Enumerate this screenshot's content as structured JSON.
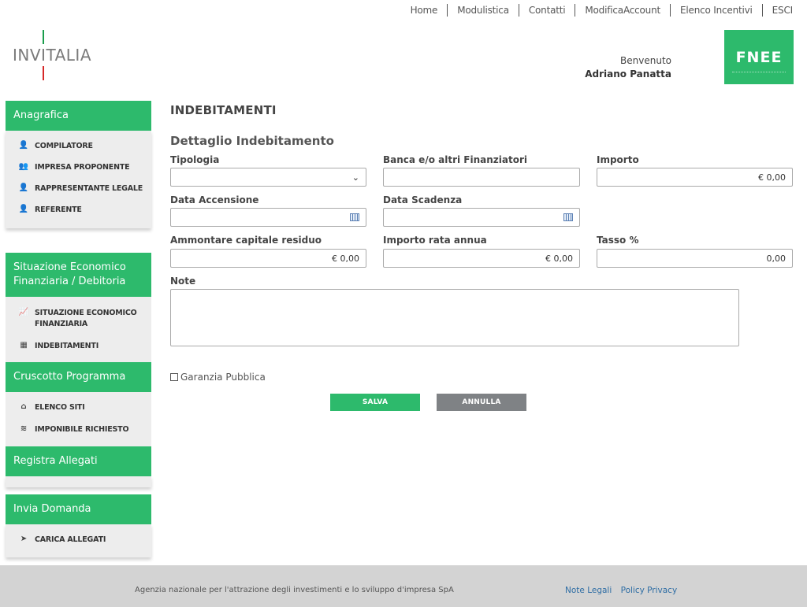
{
  "topnav": [
    "Home",
    "Modulistica",
    "Contatti",
    "ModificaAccount",
    "Elenco Incentivi",
    "ESCI"
  ],
  "brand": {
    "logo_text": "INVITALIA",
    "partner": "FNEE"
  },
  "user": {
    "greeting": "Benvenuto",
    "name": "Adriano Panatta"
  },
  "sidebar": [
    {
      "title": "Anagrafica",
      "items": [
        {
          "icon": "user-icon",
          "glyph": "👤",
          "label": "COMPILATORE"
        },
        {
          "icon": "users-icon",
          "glyph": "👥",
          "label": "IMPRESA PROPONENTE"
        },
        {
          "icon": "user-icon",
          "glyph": "👤",
          "label": "RAPPRESENTANTE LEGALE"
        },
        {
          "icon": "user-icon",
          "glyph": "👤",
          "label": "REFERENTE"
        }
      ]
    },
    {
      "title": "Situazione Economico Finanziaria / Debitoria",
      "items": [
        {
          "icon": "chart-line-icon",
          "glyph": "📈",
          "label": "SITUAZIONE ECONOMICO FINANZIARIA"
        },
        {
          "icon": "table-icon",
          "glyph": "▦",
          "label": "INDEBITAMENTI"
        }
      ]
    },
    {
      "title": "Cruscotto Programma",
      "items": [
        {
          "icon": "home-icon",
          "glyph": "⌂",
          "label": "ELENCO SITI"
        },
        {
          "icon": "coins-icon",
          "glyph": "≋",
          "label": "IMPONIBILE RICHIESTO"
        }
      ]
    },
    {
      "title": "Registra Allegati",
      "items": []
    },
    {
      "title": "Invia Domanda",
      "items": [
        {
          "icon": "send-icon",
          "glyph": "➤",
          "label": "CARICA ALLEGATI"
        }
      ]
    }
  ],
  "main": {
    "title": "INDEBITAMENTI",
    "subtitle": "Dettaglio Indebitamento",
    "fields": {
      "tipologia": {
        "label": "Tipologia",
        "value": ""
      },
      "banca": {
        "label": "Banca e/o altri Finanziatori",
        "value": ""
      },
      "importo": {
        "label": "Importo",
        "value": "€ 0,00"
      },
      "data_accensione": {
        "label": "Data Accensione",
        "value": ""
      },
      "data_scadenza": {
        "label": "Data Scadenza",
        "value": ""
      },
      "capitale_residuo": {
        "label": "Ammontare capitale residuo",
        "value": "€ 0,00"
      },
      "rata_annua": {
        "label": "Importo rata annua",
        "value": "€ 0,00"
      },
      "tasso": {
        "label": "Tasso %",
        "value": "0,00"
      },
      "note": {
        "label": "Note",
        "value": ""
      }
    },
    "garanzia_label": "Garanzia Pubblica",
    "save_label": "SALVA",
    "cancel_label": "ANNULLA"
  },
  "footer": {
    "agency": "Agenzia nazionale per l'attrazione degli investimenti e lo sviluppo d'impresa SpA",
    "links": [
      "Note Legali",
      "Policy Privacy"
    ]
  },
  "colors": {
    "accent": "#2dba6c",
    "cancel": "#7f8285",
    "footer_bg": "#d3d3d3",
    "link": "#2e6da4"
  }
}
